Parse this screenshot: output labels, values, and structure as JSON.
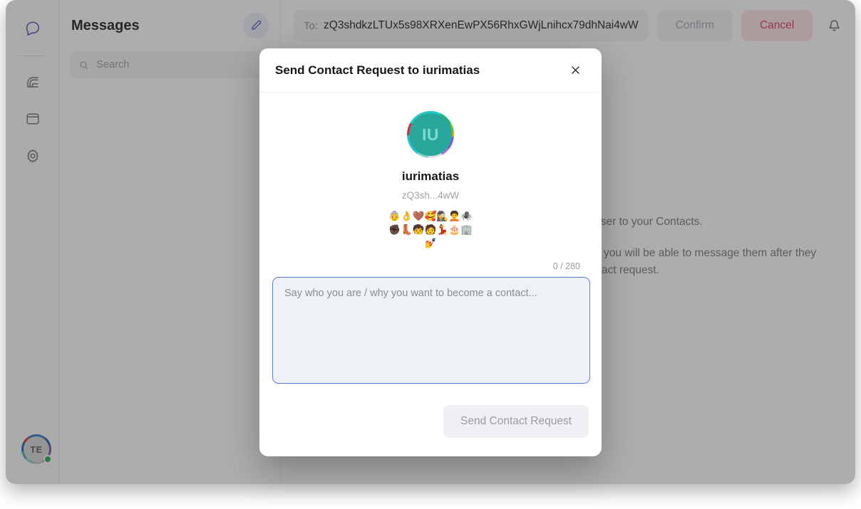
{
  "sidebar": {
    "items": [
      {
        "name": "messages",
        "icon": "chat-bubble-icon",
        "active": true
      },
      {
        "name": "feed",
        "icon": "rainbow-feed-icon",
        "active": false
      },
      {
        "name": "wallet",
        "icon": "wallet-icon",
        "active": false
      },
      {
        "name": "settings",
        "icon": "gear-icon",
        "active": false
      }
    ],
    "user_avatar_initials": "TE"
  },
  "list": {
    "title": "Messages",
    "compose_icon": "compose-pencil-icon",
    "search_placeholder": "Search",
    "search_value": "",
    "search_icon": "search-icon"
  },
  "header": {
    "to_label": "To:",
    "to_value": "zQ3shdkzLTUx5s98XRXenEwPX56RhxGWjLnihcx79dhNai4wW",
    "confirm_label": "Confirm",
    "cancel_label": "Cancel",
    "bell_icon": "notification-bell-icon"
  },
  "empty_state": {
    "line1": "Confirm the address to add this user to your Contacts.",
    "line2": "Once you confirm the person you would like to chat with, you will be able to message them after they have accepted your contact request."
  },
  "modal": {
    "title": "Send Contact Request to iurimatias",
    "close_icon": "close-icon",
    "peer": {
      "avatar_initials": "IU",
      "name": "iurimatias",
      "short_id": "zQ3sh...4wW",
      "emoji_hash": "👵👌🤎🥰🕵️‍♀️🧑‍🦱🕷️✊🏿👢🧒🧑💃🎂🏢💅"
    },
    "char_count": "0 / 280",
    "message_placeholder": "Say who you are / why you want to become a contact...",
    "message_value": "",
    "submit_label": "Send Contact Request"
  },
  "colors": {
    "accent_blue": "#3d5afe",
    "cancel_red": "#e0355a",
    "avatar_teal": "#2aa79b",
    "online_green": "#23a94a"
  }
}
